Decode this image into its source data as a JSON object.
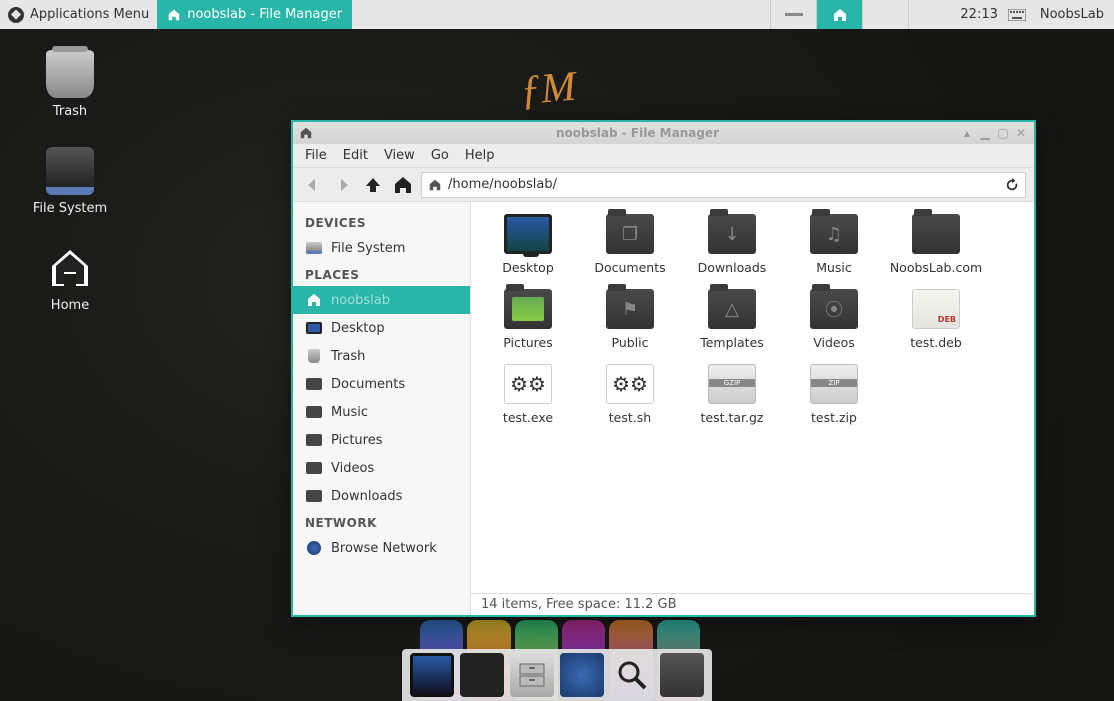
{
  "panel": {
    "apps_menu": "Applications Menu",
    "task_title": "noobslab - File Manager",
    "clock": "22:13",
    "user": "NoobsLab",
    "workspace_active_index": 1
  },
  "desktop": {
    "icons": [
      {
        "name": "trash",
        "label": "Trash"
      },
      {
        "name": "filesystem",
        "label": "File System"
      },
      {
        "name": "home",
        "label": "Home"
      }
    ],
    "signature": "ƒM"
  },
  "window": {
    "title": "noobslab - File Manager",
    "menu": [
      "File",
      "Edit",
      "View",
      "Go",
      "Help"
    ],
    "path": "/home/noobslab/",
    "sidebar": {
      "devices_header": "DEVICES",
      "devices": [
        {
          "name": "filesystem",
          "label": "File System"
        }
      ],
      "places_header": "PLACES",
      "places": [
        {
          "name": "noobslab",
          "label": "noobslab",
          "selected": true
        },
        {
          "name": "desktop",
          "label": "Desktop"
        },
        {
          "name": "trash",
          "label": "Trash"
        },
        {
          "name": "documents",
          "label": "Documents"
        },
        {
          "name": "music",
          "label": "Music"
        },
        {
          "name": "pictures",
          "label": "Pictures"
        },
        {
          "name": "videos",
          "label": "Videos"
        },
        {
          "name": "downloads",
          "label": "Downloads"
        }
      ],
      "network_header": "NETWORK",
      "network": [
        {
          "name": "browse-network",
          "label": "Browse Network"
        }
      ]
    },
    "items": [
      {
        "name": "Desktop",
        "type": "monitor"
      },
      {
        "name": "Documents",
        "type": "folder",
        "glyph": "❐"
      },
      {
        "name": "Downloads",
        "type": "folder",
        "glyph": "↓"
      },
      {
        "name": "Music",
        "type": "folder",
        "glyph": "♫"
      },
      {
        "name": "NoobsLab.com",
        "type": "folder",
        "glyph": ""
      },
      {
        "name": "Pictures",
        "type": "picfolder"
      },
      {
        "name": "Public",
        "type": "folder",
        "glyph": "⚑"
      },
      {
        "name": "Templates",
        "type": "folder",
        "glyph": "△"
      },
      {
        "name": "Videos",
        "type": "folder",
        "glyph": "⦿"
      },
      {
        "name": "test.deb",
        "type": "pkg",
        "pkglabel": "DEB"
      },
      {
        "name": "test.exe",
        "type": "gears"
      },
      {
        "name": "test.sh",
        "type": "gears"
      },
      {
        "name": "test.tar.gz",
        "type": "archive",
        "pkglabel": "GZIP"
      },
      {
        "name": "test.zip",
        "type": "archive",
        "pkglabel": "ZIP"
      }
    ],
    "status": "14 items, Free space: 11.2 GB"
  },
  "dock": {
    "items": [
      "display",
      "terminal",
      "file-manager",
      "web-browser",
      "search",
      "folder"
    ]
  }
}
